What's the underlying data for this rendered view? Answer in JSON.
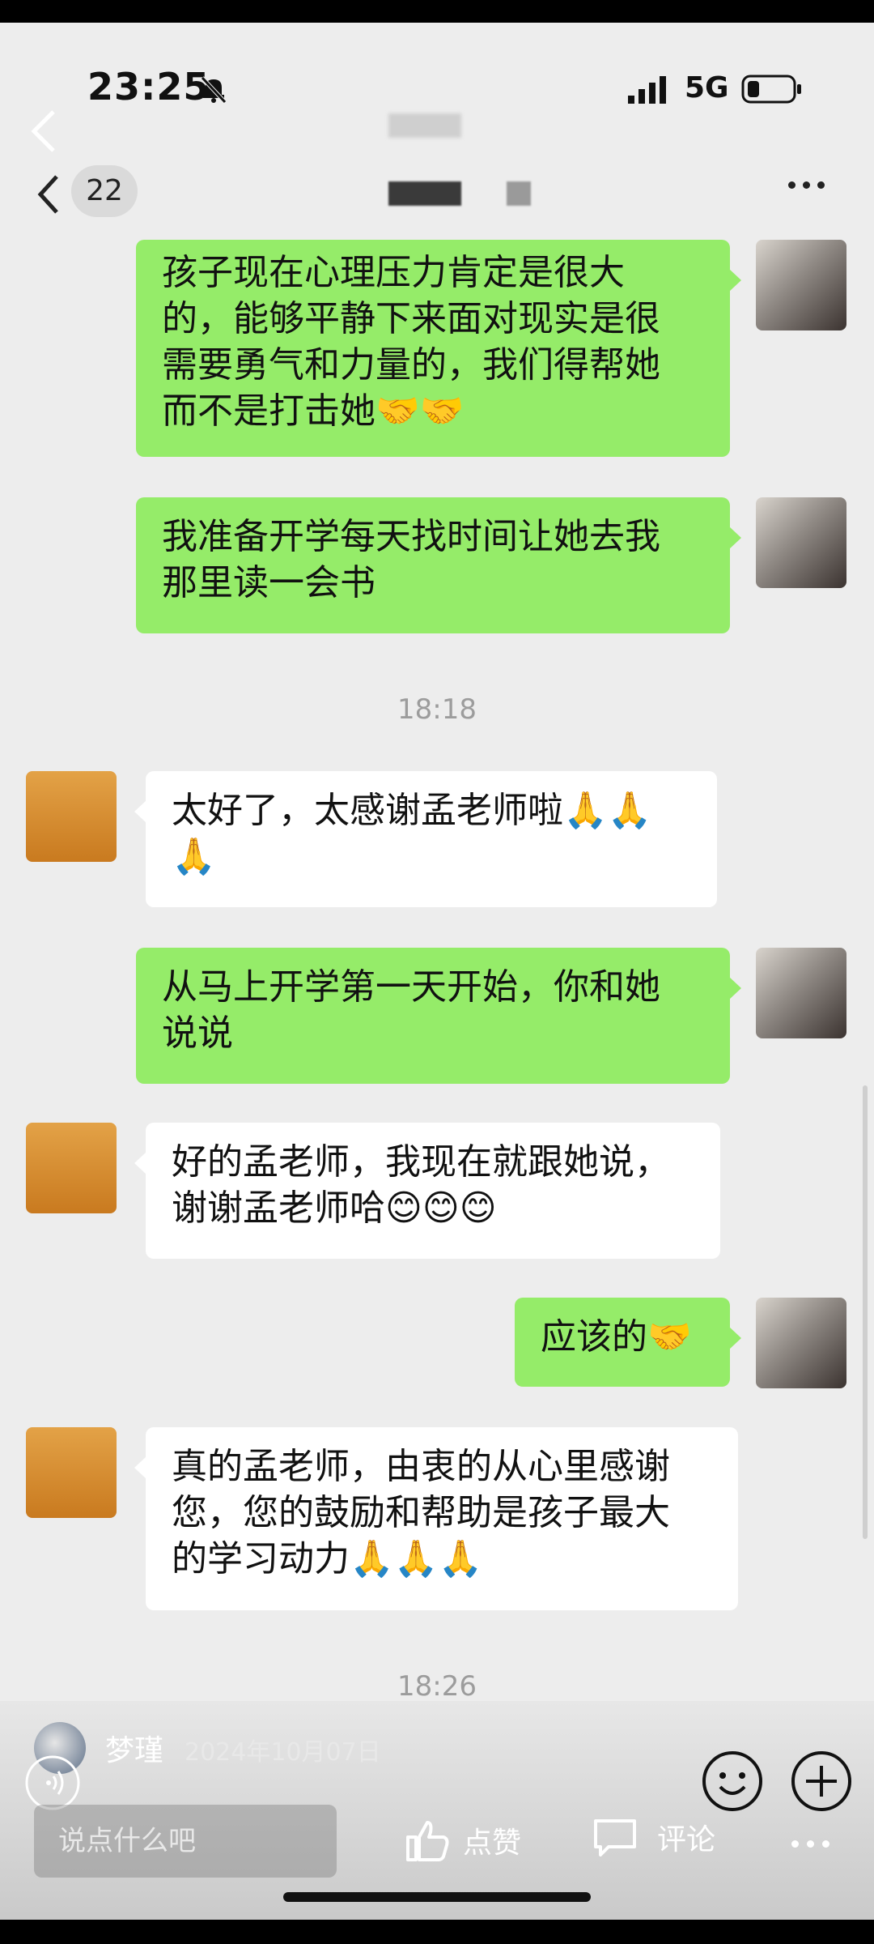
{
  "status": {
    "time": "23:25",
    "network": "5G"
  },
  "nav": {
    "count": "22"
  },
  "messages": [
    {
      "text": "孩子现在心理压力肯定是很大\n的，能够平静下来面对现实是很\n需要勇气和力量的，我们得帮她\n而不是打击她🤝🤝"
    },
    {
      "text": "我准备开学每天找时间让她去我\n那里读一会书"
    },
    {
      "time": "18:18"
    },
    {
      "text": "太好了，太感谢孟老师啦🙏🙏\n🙏"
    },
    {
      "text": "从马上开学第一天开始，你和她\n说说"
    },
    {
      "text": "好的孟老师，我现在就跟她说，\n谢谢孟老师哈😊😊😊"
    },
    {
      "text": "应该的🤝"
    },
    {
      "text": "真的孟老师，由衷的从心里感谢\n您，您的鼓励和帮助是孩子最大\n的学习动力🙏🙏🙏"
    },
    {
      "time": "18:26"
    }
  ],
  "post": {
    "author": "梦瑾",
    "date": "2024年10月07日",
    "comment_placeholder": "说点什么吧",
    "like_label": "点赞",
    "comment_label": "评论"
  },
  "colors": {
    "my_bubble": "#95ec69",
    "other_bubble": "#ffffff",
    "background": "#ededed"
  }
}
